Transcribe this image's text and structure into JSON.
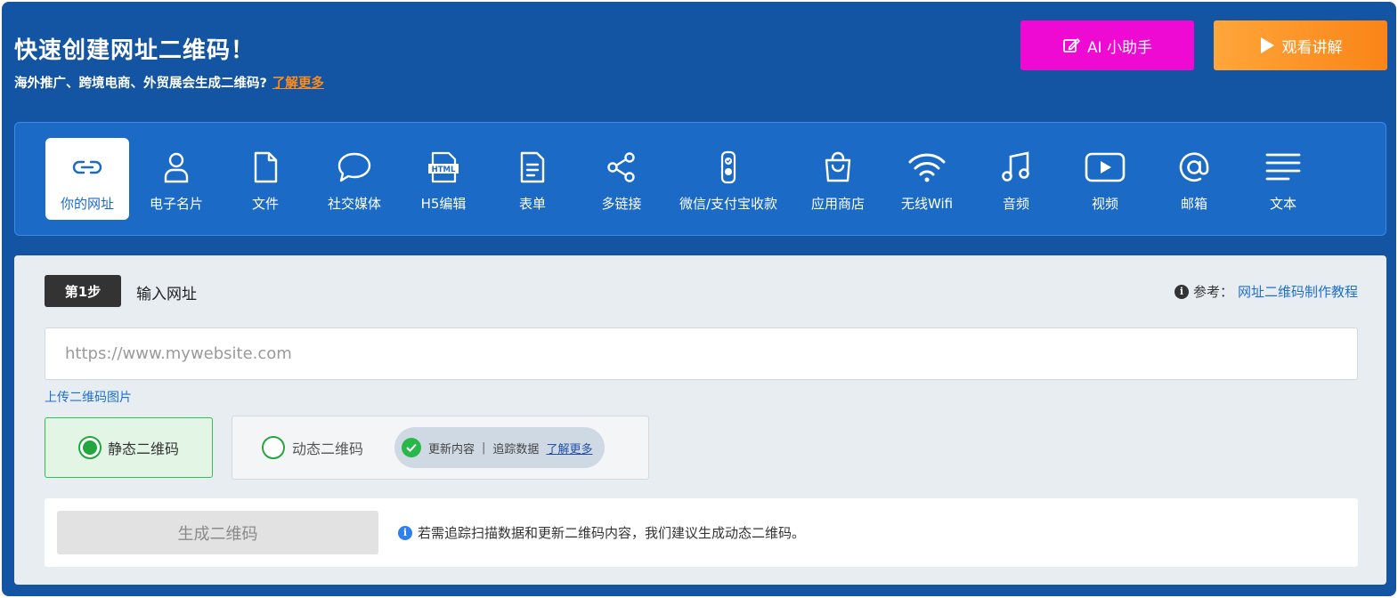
{
  "header": {
    "title": "快速创建网址二维码！",
    "subtitle": "海外推广、跨境电商、外贸展会生成二维码?",
    "learn_more": "了解更多",
    "ai_button": "AI 小助手",
    "video_button": "观看讲解"
  },
  "types": [
    {
      "label": "你的网址",
      "icon": "link-icon",
      "active": true
    },
    {
      "label": "电子名片",
      "icon": "user-icon"
    },
    {
      "label": "文件",
      "icon": "file-icon"
    },
    {
      "label": "社交媒体",
      "icon": "chat-bubble-icon"
    },
    {
      "label": "H5编辑",
      "icon": "html-file-icon"
    },
    {
      "label": "表单",
      "icon": "form-icon"
    },
    {
      "label": "多链接",
      "icon": "share-icon"
    },
    {
      "label": "微信/支付宝收款",
      "icon": "payment-icon"
    },
    {
      "label": "应用商店",
      "icon": "shopping-bag-icon"
    },
    {
      "label": "无线Wifi",
      "icon": "wifi-icon"
    },
    {
      "label": "音频",
      "icon": "music-note-icon"
    },
    {
      "label": "视频",
      "icon": "play-video-icon"
    },
    {
      "label": "邮箱",
      "icon": "at-sign-icon"
    },
    {
      "label": "文本",
      "icon": "text-lines-icon"
    }
  ],
  "step": {
    "badge": "第1步",
    "label": "输入网址",
    "ref_prefix": "参考：",
    "ref_link": "网址二维码制作教程"
  },
  "url_input": {
    "placeholder": "https://www.mywebsite.com",
    "value": ""
  },
  "upload_link": "上传二维码图片",
  "options": {
    "static_label": "静态二维码",
    "dynamic_label": "动态二维码",
    "selected": "static",
    "features": "更新内容",
    "separator": "|",
    "tracking": "追踪数据",
    "learn_more": "了解更多"
  },
  "generate": {
    "button": "生成二维码",
    "hint": "若需追踪扫描数据和更新二维码内容，我们建议生成动态二维码。"
  },
  "colors": {
    "background_blue": "#1354a3",
    "types_bar_blue": "#1b6bc6",
    "ai_button_magenta": "#ee0ad2",
    "video_button_orange": "#fa8417",
    "link_orange": "#ff8c1a",
    "selected_green": "#23a63f"
  }
}
